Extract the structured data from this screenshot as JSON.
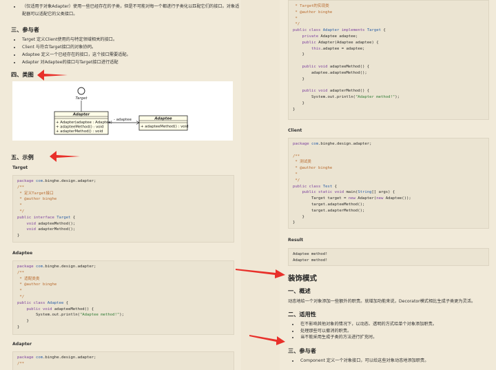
{
  "left": {
    "intro_bullet": "（仅适用于对象Adapter）使用一些已经存在的子类，但是不可能对每一个都进行子类化以匹配它们的接口。对象适配器可以适配它的父类接口。",
    "participants_heading": "三、参与者",
    "participants": [
      "Target 定义Client使用的与特定领域相关的接口。",
      "Client 与符合Target接口的对象协同。",
      "Adaptee 定义一个已经存在的接口，这个接口需要适配。",
      "Adapter 对Adaptee的接口与Target接口进行适配"
    ],
    "class_diagram_heading": "四、类图",
    "diagram": {
      "target_label": "Target",
      "adapter_title": "Adapter",
      "adapter_ctor": "+ Adapter(adaptee : Adaptee)",
      "adapter_m1": "+ adapteeMethod() : void",
      "adapter_m2": "+ adapterMethod() : void",
      "assoc_label": "- adaptee",
      "adaptee_title": "Adaptee",
      "adaptee_m1": "+ adapteeMethod() : void"
    },
    "example_heading": "五、示例",
    "target_label": "Target",
    "adaptee_label": "Adaptee",
    "adapter_label": "Adapter"
  },
  "right": {
    "client_label": "Client",
    "result_label": "Result",
    "result_lines": [
      "Adaptee method!",
      "Adapter method!"
    ],
    "decorator_heading": "装饰模式",
    "overview_heading": "一、概述",
    "overview_text": "动态地给一个对象添加一些额外的职责。就增加功能来说，Decorator模式相比生成子类更为灵活。",
    "applicability_heading": "二、适用性",
    "applicability": [
      "在不影响其他对象的情况下，以动态、透明的方式给单个对象添加职责。",
      "处理那些可以撤消的职责。",
      "当不能采用生成子类的方法进行扩充时。"
    ],
    "participants_heading": "三、参与者",
    "participants_first": "Component 定义一个对象接口，可以给这些对象动态地添加职责。"
  },
  "colors": {
    "page_bg": "#f1ead9",
    "code_bg": "#ebe4d2",
    "arrow": "#e8302a",
    "comment": "#b86a2e",
    "keyword": "#7a3e9d",
    "string": "#2f7a34",
    "type": "#2b5fa6"
  }
}
